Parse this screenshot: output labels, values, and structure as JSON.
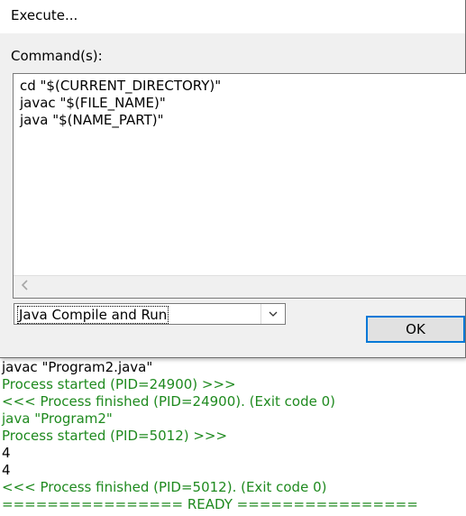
{
  "dialog": {
    "title": "Execute...",
    "commands_label": "Command(s):",
    "commands": [
      "cd \"$(CURRENT_DIRECTORY)\"",
      "javac \"$(FILE_NAME)\"",
      "java \"$(NAME_PART)\""
    ],
    "preset_value": "Java Compile and Run",
    "ok_label": "OK"
  },
  "console": {
    "lines": [
      "javac \"Program2.java\"",
      "Process started (PID=24900) >>>",
      "<<< Process finished (PID=24900). (Exit code 0)",
      "java \"Program2\"",
      "Process started (PID=5012) >>>",
      "4",
      "4",
      "<<< Process finished (PID=5012). (Exit code 0)",
      "================ READY ================"
    ]
  },
  "colors": {
    "console_green": "#1f8a1f",
    "console_black": "#000000",
    "accent_blue": "#0078d7",
    "dialog_bg": "#f0f0f0"
  },
  "icons": {
    "scroll_left": "scroll-left-arrow-icon",
    "dropdown": "chevron-down-icon"
  }
}
